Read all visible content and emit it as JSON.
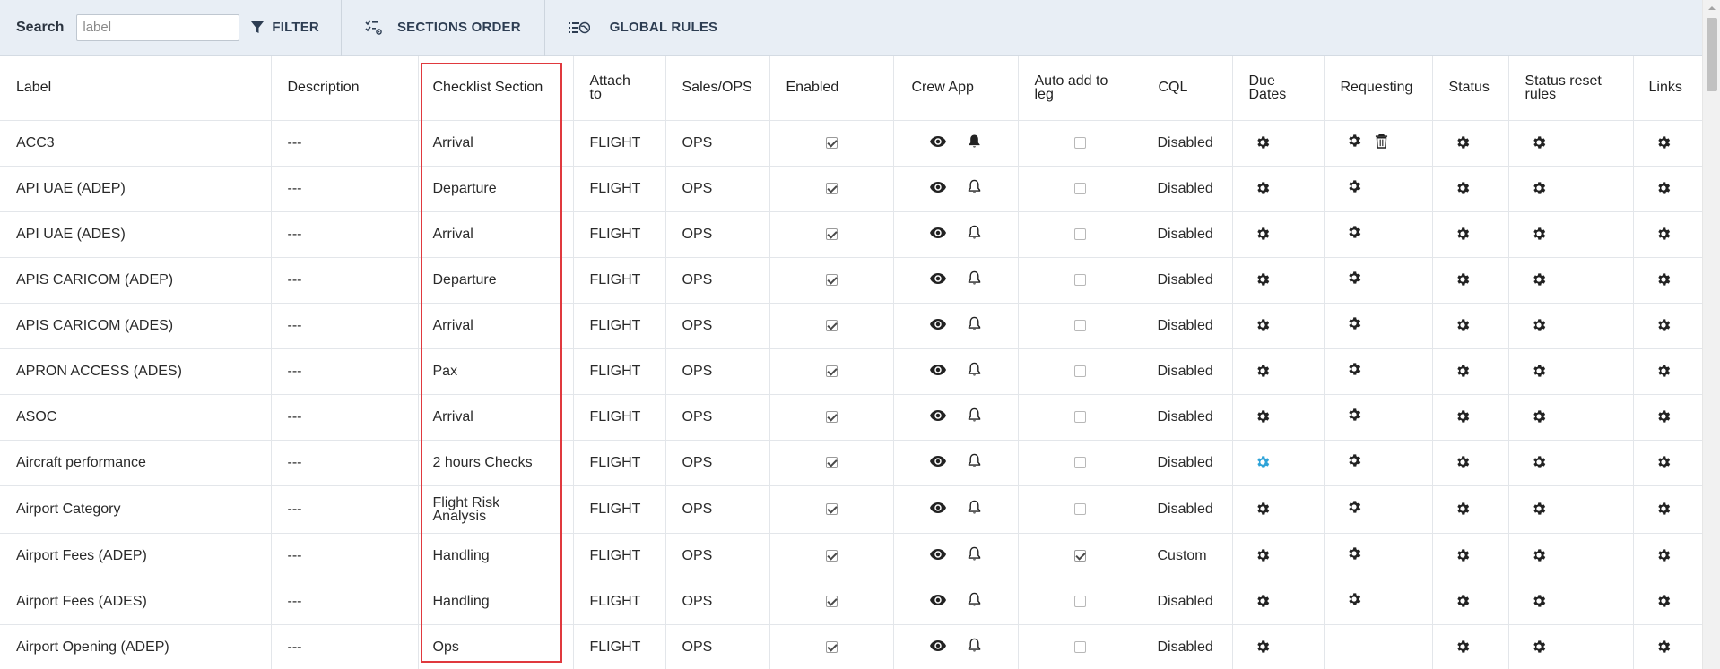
{
  "toolbar": {
    "search_label": "Search",
    "search_placeholder": "label",
    "filter_label": "FILTER",
    "sections_order_label": "SECTIONS ORDER",
    "global_rules_label": "GLOBAL RULES"
  },
  "columns": {
    "label": "Label",
    "description": "Description",
    "checklist_section": "Checklist Section",
    "attach_to": "Attach to",
    "sales_ops": "Sales/OPS",
    "enabled": "Enabled",
    "crew_app": "Crew App",
    "auto_add": "Auto add to leg",
    "cql": "CQL",
    "due_dates": "Due Dates",
    "requesting": "Requesting",
    "status": "Status",
    "status_reset": "Status reset rules",
    "links": "Links"
  },
  "rows": [
    {
      "label": "ACC3",
      "description": "---",
      "section": "Arrival",
      "attach": "FLIGHT",
      "sales_ops": "OPS",
      "cql": "Disabled"
    },
    {
      "label": "API UAE (ADEP)",
      "description": "---",
      "section": "Departure",
      "attach": "FLIGHT",
      "sales_ops": "OPS",
      "cql": "Disabled"
    },
    {
      "label": "API UAE (ADES)",
      "description": "---",
      "section": "Arrival",
      "attach": "FLIGHT",
      "sales_ops": "OPS",
      "cql": "Disabled"
    },
    {
      "label": "APIS CARICOM (ADEP)",
      "description": "---",
      "section": "Departure",
      "attach": "FLIGHT",
      "sales_ops": "OPS",
      "cql": "Disabled"
    },
    {
      "label": "APIS CARICOM (ADES)",
      "description": "---",
      "section": "Arrival",
      "attach": "FLIGHT",
      "sales_ops": "OPS",
      "cql": "Disabled"
    },
    {
      "label": "APRON ACCESS (ADES)",
      "description": "---",
      "section": "Pax",
      "attach": "FLIGHT",
      "sales_ops": "OPS",
      "cql": "Disabled"
    },
    {
      "label": "ASOC",
      "description": "---",
      "section": "Arrival",
      "attach": "FLIGHT",
      "sales_ops": "OPS",
      "cql": "Disabled"
    },
    {
      "label": "Aircraft performance",
      "description": "---",
      "section": "2 hours Checks",
      "attach": "FLIGHT",
      "sales_ops": "OPS",
      "cql": "Disabled"
    },
    {
      "label": "Airport Category",
      "description": "---",
      "section": "Flight Risk Analysis",
      "attach": "FLIGHT",
      "sales_ops": "OPS",
      "cql": "Disabled"
    },
    {
      "label": "Airport Fees (ADEP)",
      "description": "---",
      "section": "Handling",
      "attach": "FLIGHT",
      "sales_ops": "OPS",
      "cql": "Custom"
    },
    {
      "label": "Airport Fees (ADES)",
      "description": "---",
      "section": "Handling",
      "attach": "FLIGHT",
      "sales_ops": "OPS",
      "cql": "Disabled"
    },
    {
      "label": "Airport Opening (ADEP)",
      "description": "---",
      "section": "Ops",
      "attach": "FLIGHT",
      "sales_ops": "OPS",
      "cql": "Disabled"
    }
  ],
  "colors": {
    "toolbar_bg": "#e8eef5",
    "highlight": "#e0393e",
    "active_gear": "#2ea3d8",
    "icon": "#222222"
  }
}
